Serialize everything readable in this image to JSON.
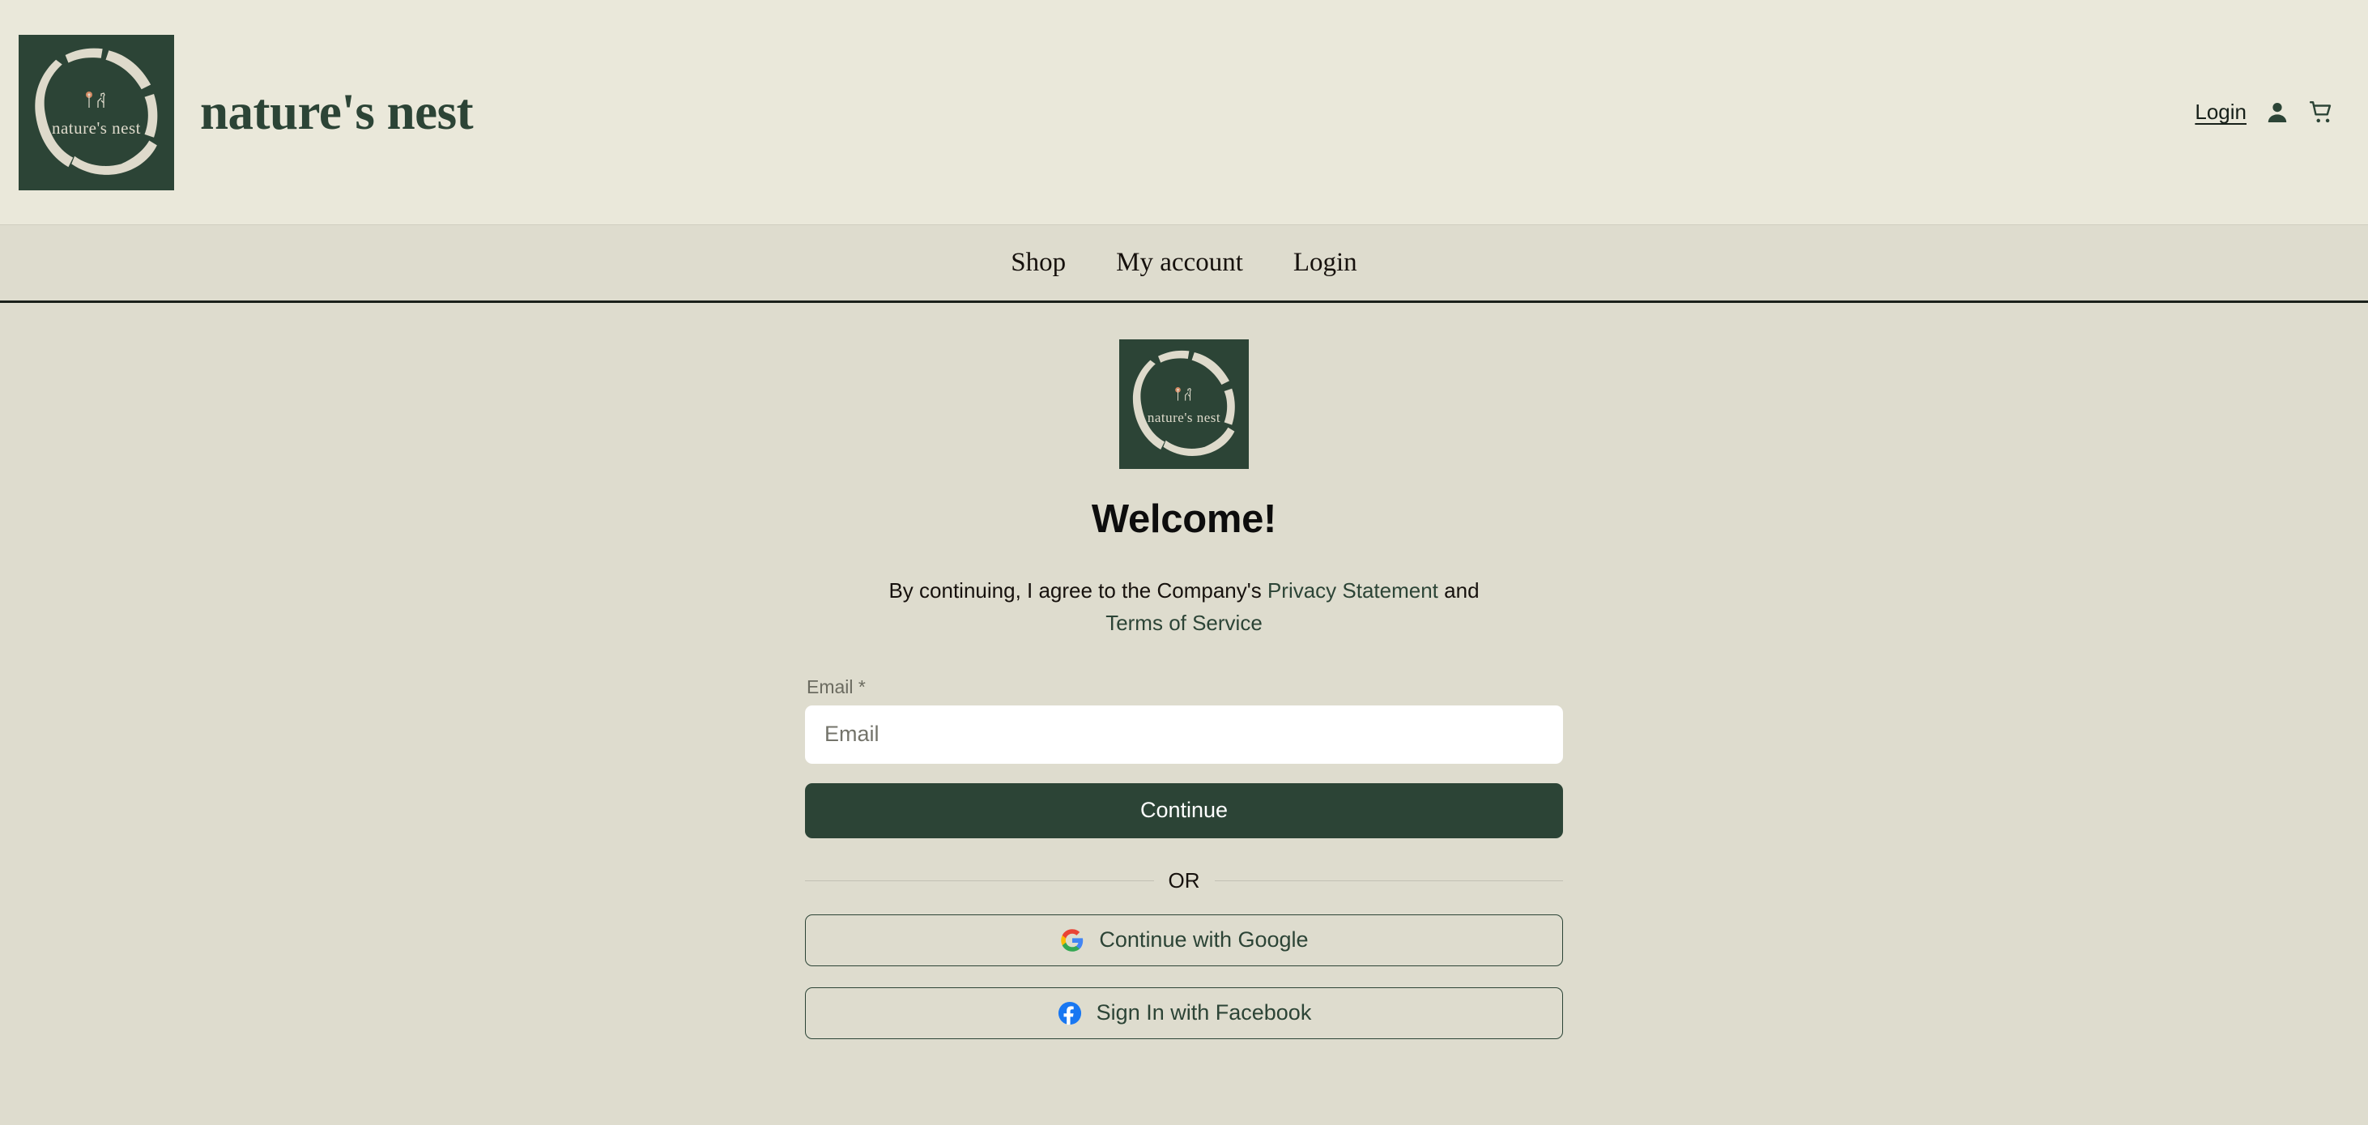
{
  "header": {
    "brand_name": "nature's nest",
    "logo_text": "nature's nest",
    "login_label": "Login",
    "account_icon": "person-icon",
    "cart_icon": "shopping-cart-icon"
  },
  "nav": {
    "items": [
      {
        "label": "Shop"
      },
      {
        "label": "My account"
      },
      {
        "label": "Login"
      }
    ]
  },
  "auth": {
    "logo_text": "nature's nest",
    "title": "Welcome!",
    "legal_prefix": "By continuing, I agree to the Company's ",
    "privacy_link": "Privacy Statement",
    "legal_conjunction": " and ",
    "terms_link": "Terms of Service",
    "email_label": "Email *",
    "email_value": "",
    "email_placeholder": "Email",
    "continue_label": "Continue",
    "divider_label": "OR",
    "google_label": "Continue with Google",
    "google_icon": "google-g-icon",
    "facebook_label": "Sign In with Facebook",
    "facebook_icon": "facebook-f-icon"
  },
  "colors": {
    "brand_green": "#2c4436",
    "header_bg": "#eae8da",
    "body_bg": "#dedcce",
    "logo_cream": "#dedacb",
    "google_blue": "#4285f4",
    "google_red": "#ea4335",
    "google_yellow": "#fbbc05",
    "google_green": "#34a853",
    "facebook_blue": "#1877f2"
  }
}
